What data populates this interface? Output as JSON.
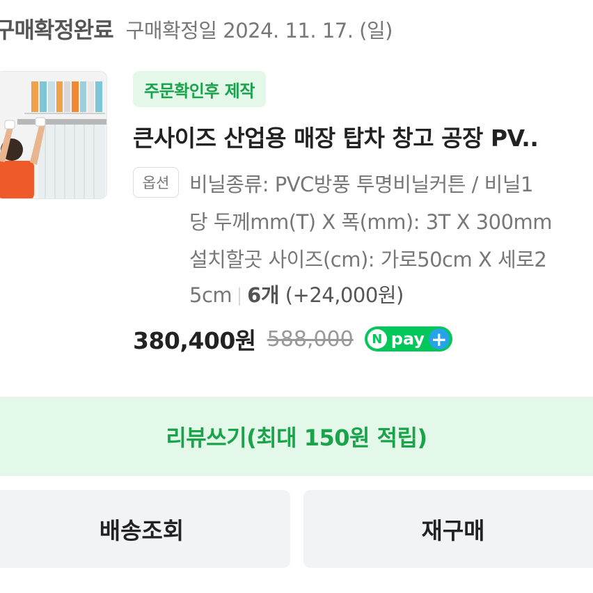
{
  "order": {
    "status_title": "구매확정완료",
    "confirm_date": "구매확정일 2024. 11. 17. (일)"
  },
  "product": {
    "badge": "주문확인후 제작",
    "title": "큰사이즈 산업용 매장 탑차 창고 공장 PV..",
    "option_label": "옵션",
    "option_lines": [
      "비닐종류: PVC방풍 투명비닐커튼 / 비닐1",
      "당 두께mm(T) X 폭(mm): 3T X 300mm",
      "설치할곳 사이즈(cm): 가로50cm X 세로2"
    ],
    "option_last": "5cm",
    "quantity": "6개",
    "extra_price": "(+24,000원)",
    "price": "380,400원",
    "original_price": "588,000",
    "npay": {
      "n": "N",
      "word": "pay",
      "plus": "+"
    }
  },
  "actions": {
    "review": "리뷰쓰기(최대 150원 적립)",
    "tracking": "배송조회",
    "reorder": "재구매"
  }
}
